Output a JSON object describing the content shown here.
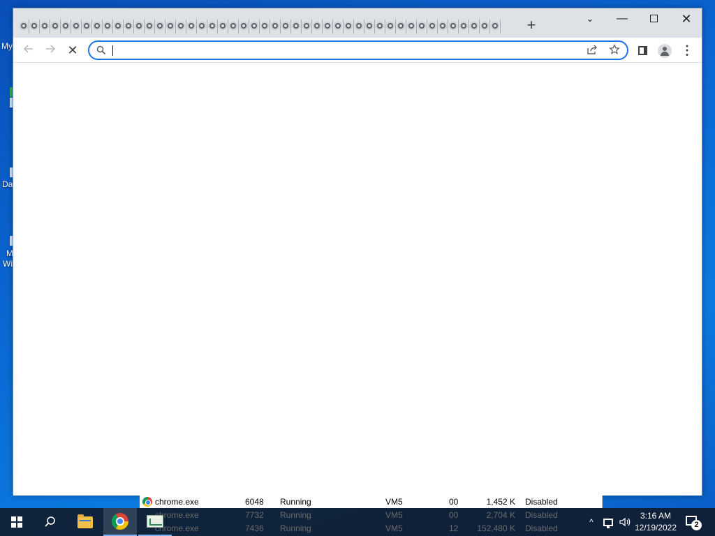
{
  "desktop": {
    "labels": [
      "My",
      "Da",
      "M",
      "Wi"
    ]
  },
  "browser": {
    "tab_count": 46,
    "new_tab_label": "+",
    "window_controls": {
      "tab_search": "⌄",
      "minimize": "—",
      "close": "✕"
    },
    "toolbar": {
      "back_icon": "arrow-left-icon",
      "forward_icon": "arrow-right-icon",
      "stop_label": "✕",
      "menu_label": "⋮"
    },
    "omnibox": {
      "value": "",
      "placeholder": ""
    }
  },
  "task_manager": {
    "rows": [
      {
        "name": "chrome.exe",
        "pid": "6048",
        "status": "Running",
        "user": "VM5",
        "cpu": "00",
        "memory": "1,452 K",
        "uac": "Disabled"
      },
      {
        "name": "chrome.exe",
        "pid": "7732",
        "status": "Running",
        "user": "VM5",
        "cpu": "00",
        "memory": "2,704 K",
        "uac": "Disabled"
      },
      {
        "name": "chrome.exe",
        "pid": "7436",
        "status": "Running",
        "user": "VM5",
        "cpu": "12",
        "memory": "152,480 K",
        "uac": "Disabled"
      }
    ]
  },
  "taskbar": {
    "clock_time": "3:16 AM",
    "clock_date": "12/19/2022",
    "notification_count": "2",
    "tray_chevron": "^"
  },
  "colors": {
    "accent": "#1a73e8",
    "tabstrip": "#dee1e6",
    "desktop": "#0a6ad6",
    "taskbar": "#101824"
  }
}
